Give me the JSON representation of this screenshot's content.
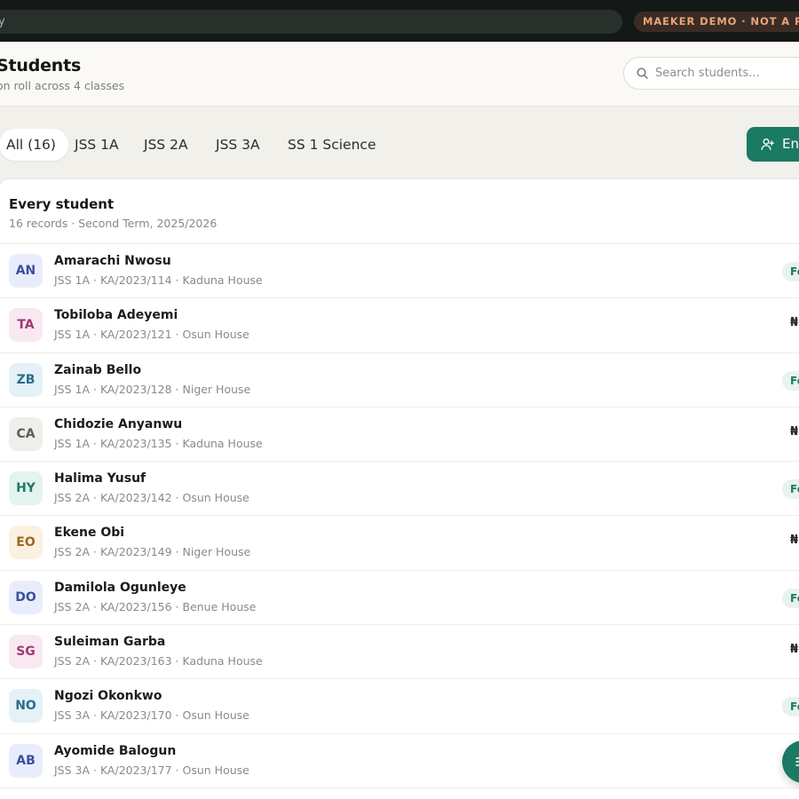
{
  "browser": {
    "address_fragment": "y",
    "demo_badge": "MAEKER DEMO · NOT A REAL"
  },
  "header": {
    "title": "Students",
    "subtitle": "on roll across 4 classes",
    "search_placeholder": "Search students..."
  },
  "tabs": [
    {
      "label": "All (16)",
      "active": true
    },
    {
      "label": "JSS 1A",
      "active": false
    },
    {
      "label": "JSS 2A",
      "active": false
    },
    {
      "label": "JSS 3A",
      "active": false
    },
    {
      "label": "SS 1 Science",
      "active": false
    }
  ],
  "actions": {
    "enrol_label": "En"
  },
  "list": {
    "title": "Every student",
    "subtitle": "16 records · Second Term, 2025/2026",
    "students": [
      {
        "initials": "AN",
        "name": "Amarachi Nwosu",
        "meta": "JSS 1A · KA/2023/114 · Kaduna House",
        "status": "Fe",
        "status_kind": "pill",
        "avatar_bg": "#e9edfb",
        "avatar_fg": "#3b4fa0"
      },
      {
        "initials": "TA",
        "name": "Tobiloba Adeyemi",
        "meta": "JSS 1A · KA/2023/121 · Osun House",
        "status": "₦",
        "status_kind": "amount",
        "avatar_bg": "#f8e8f2",
        "avatar_fg": "#a2386f"
      },
      {
        "initials": "ZB",
        "name": "Zainab Bello",
        "meta": "JSS 1A · KA/2023/128 · Niger House",
        "status": "Fe",
        "status_kind": "pill",
        "avatar_bg": "#e4f1f7",
        "avatar_fg": "#2c6d8a"
      },
      {
        "initials": "CA",
        "name": "Chidozie Anyanwu",
        "meta": "JSS 1A · KA/2023/135 · Kaduna House",
        "status": "₦",
        "status_kind": "amount",
        "avatar_bg": "#efeeea",
        "avatar_fg": "#5b5d57"
      },
      {
        "initials": "HY",
        "name": "Halima Yusuf",
        "meta": "JSS 2A · KA/2023/142 · Osun House",
        "status": "Fe",
        "status_kind": "pill",
        "avatar_bg": "#e3f3ee",
        "avatar_fg": "#1f7a62"
      },
      {
        "initials": "EO",
        "name": "Ekene Obi",
        "meta": "JSS 2A · KA/2023/149 · Niger House",
        "status": "₦",
        "status_kind": "amount",
        "avatar_bg": "#fbf1e1",
        "avatar_fg": "#9a6a1c"
      },
      {
        "initials": "DO",
        "name": "Damilola Ogunleye",
        "meta": "JSS 2A · KA/2023/156 · Benue House",
        "status": "Fe",
        "status_kind": "pill",
        "avatar_bg": "#e9edfb",
        "avatar_fg": "#3b4fa0"
      },
      {
        "initials": "SG",
        "name": "Suleiman Garba",
        "meta": "JSS 2A · KA/2023/163 · Kaduna House",
        "status": "₦",
        "status_kind": "amount",
        "avatar_bg": "#f8e8f2",
        "avatar_fg": "#a2386f"
      },
      {
        "initials": "NO",
        "name": "Ngozi Okonkwo",
        "meta": "JSS 3A · KA/2023/170 · Osun House",
        "status": "Fe",
        "status_kind": "pill",
        "avatar_bg": "#e4f1f7",
        "avatar_fg": "#2c6d8a"
      },
      {
        "initials": "AB",
        "name": "Ayomide Balogun",
        "meta": "JSS 3A · KA/2023/177 · Osun House",
        "status": "",
        "status_kind": "none",
        "avatar_bg": "#e9edfb",
        "avatar_fg": "#3b4fa0"
      }
    ]
  }
}
